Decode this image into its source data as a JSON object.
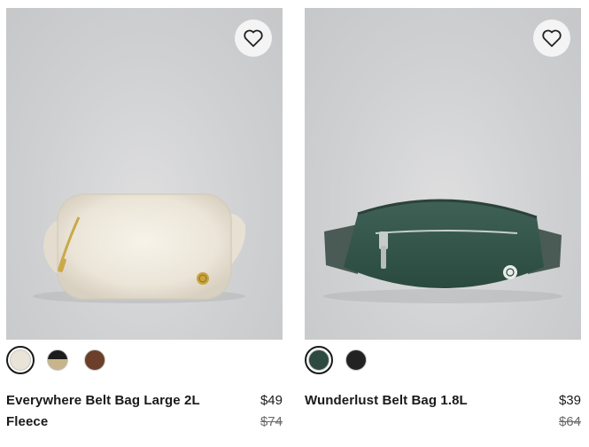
{
  "products": [
    {
      "name": "Everywhere Belt Bag Large 2L Fleece",
      "price": "$49",
      "original_price": "$74",
      "icon": "heart-outline-icon",
      "swatches": [
        {
          "name": "white-fleece",
          "color": "#e9e3d8",
          "selected": true
        },
        {
          "name": "black-tan",
          "color": "split-black-tan",
          "selected": false
        },
        {
          "name": "brown",
          "color": "#6b3f2a",
          "selected": false
        }
      ]
    },
    {
      "name": "Wunderlust Belt Bag 1.8L",
      "price": "$39",
      "original_price": "$64",
      "icon": "heart-outline-icon",
      "swatches": [
        {
          "name": "dark-green",
          "color": "#2e4a40",
          "selected": true
        },
        {
          "name": "black",
          "color": "#222222",
          "selected": false
        }
      ]
    }
  ]
}
